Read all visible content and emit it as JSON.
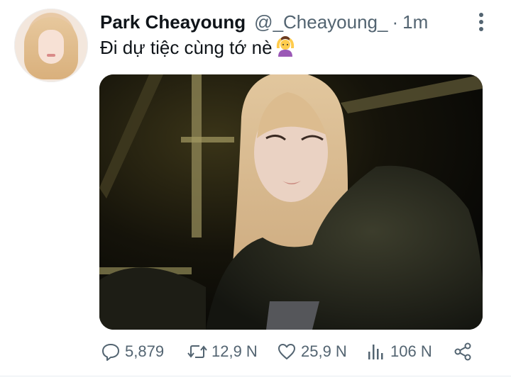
{
  "tweet": {
    "author_name": "Park Cheayoung",
    "handle": "@_Cheayoung_",
    "separator": "·",
    "time": "1m",
    "text": "Đi dự tiệc cùng tớ nè",
    "emoji": "🙆‍♀️"
  },
  "actions": {
    "replies": "5,879",
    "retweets": "12,9 N",
    "likes": "25,9 N",
    "views": "106 N"
  },
  "icons": {
    "reply": "speech-bubble",
    "retweet": "retweet-arrows",
    "like": "heart",
    "views": "bar-chart",
    "share": "share-nodes",
    "more": "vertical-ellipsis"
  },
  "colors": {
    "text_primary": "#0f1419",
    "text_secondary": "#536471",
    "divider": "#e6ecf0"
  }
}
